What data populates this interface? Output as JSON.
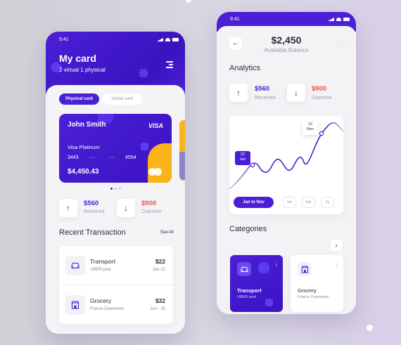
{
  "status": {
    "time": "9:41"
  },
  "left_phone": {
    "header": {
      "title": "My card",
      "subtitle": "2 virtual 1 physical"
    },
    "segments": [
      {
        "label": "Physical card",
        "active": true
      },
      {
        "label": "Virtual card",
        "active": false
      }
    ],
    "card": {
      "holder": "John Smith",
      "brand": "VISA",
      "type": "Visa Platinum",
      "number_groups": [
        "3443",
        "····",
        "····",
        "4554"
      ],
      "balance": "$4,450.43",
      "colors": {
        "base": "#4b1fd6",
        "accent": "#f9b41a"
      }
    },
    "stats": {
      "received": {
        "value": "$560",
        "label": "Received",
        "color": "#4b1fd6",
        "icon": "arrow-up-icon"
      },
      "outcome": {
        "value": "$900",
        "label": "Outcome",
        "color": "#ef4e4e",
        "icon": "arrow-down-icon"
      }
    },
    "recent": {
      "title": "Recent Transaction",
      "see_all": "See All",
      "items": [
        {
          "title": "Transport",
          "subtitle": "UBER pool",
          "amount": "$22",
          "date": "Jan-22",
          "icon": "car-icon"
        },
        {
          "title": "Grocery",
          "subtitle": "France Downtown",
          "amount": "$32",
          "date": "Jun - 26",
          "icon": "store-icon"
        }
      ]
    }
  },
  "right_phone": {
    "balance": "$2,450",
    "balance_label": "Availabla Balance",
    "analytics_title": "Analytics",
    "stats": {
      "received": {
        "value": "$560",
        "label": "Received",
        "color": "#4b1fd6"
      },
      "outcome": {
        "value": "$900",
        "label": "Outcome",
        "color": "#ef4e4e"
      }
    },
    "chart": {
      "tooltip_low": {
        "day": "22",
        "month": "Jan"
      },
      "tooltip_high": {
        "day": "12",
        "month": "Nov"
      },
      "range_pill": "Jan to Nov",
      "periods": [
        "1m",
        "6m",
        "1y"
      ]
    },
    "categories": {
      "title": "Categories",
      "items": [
        {
          "title": "Transport",
          "subtitle": "UBER pool",
          "icon": "car-icon",
          "active": true
        },
        {
          "title": "Grocery",
          "subtitle": "France Downtown",
          "icon": "store-icon",
          "active": false
        }
      ]
    }
  }
}
